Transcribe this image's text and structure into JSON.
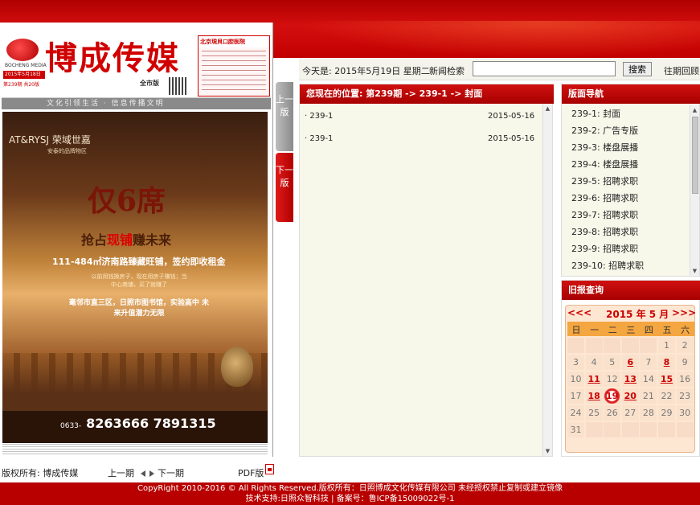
{
  "masthead": {
    "brand": "博成传媒",
    "logo_text": "BOCHENG MEDIA",
    "date_badge": "2015年5月18日",
    "issue_line": "第239期  共20版",
    "edition": "全市版",
    "ad_headline": "北京現貝口腔医院",
    "slogan": "文化引领生活 · 信息传播文明"
  },
  "ad": {
    "brand": "AT&RYSJ 荣域世嘉",
    "tagline": "安泰的品牌物区",
    "big": "仅6席",
    "sub_pre": "抢占",
    "sub_highlight": "现铺",
    "sub_post": "赚未来",
    "line": "111-484㎡济南路臻藏旺铺，签约即收租金",
    "small": "以前用钱换房子，现在用房子赚钱；当中心商铺，买了就赚了",
    "location": "毫邻市直三区，日照市图书馆，实验高中 未来升值潜力无限",
    "phone_label": "0633-",
    "phone": "8263666  7891315"
  },
  "page_buttons": {
    "prev": "上一版",
    "next": "下一版"
  },
  "datebar": {
    "today": "今天是: 2015年5月19日 星期二",
    "search_label": "新闻检索",
    "search_value": "",
    "search_button": "搜索",
    "history": "往期回顾"
  },
  "middle": {
    "location": "您现在的位置: 第239期 -> 239-1 -> 封面",
    "articles": [
      {
        "title": "· 239-1",
        "date": "2015-05-16"
      },
      {
        "title": "· 239-1",
        "date": "2015-05-16"
      }
    ]
  },
  "right": {
    "title": "版面导航",
    "items": [
      "239-1: 封面",
      "239-2: 广告专版",
      "239-3: 楼盘展播",
      "239-4: 楼盘展播",
      "239-5: 招聘求职",
      "239-6: 招聘求职",
      "239-7: 招聘求职",
      "239-8: 招聘求职",
      "239-9: 招聘求职",
      "239-10: 招聘求职"
    ]
  },
  "calendar": {
    "title": "旧报查询",
    "prev": "<<<",
    "month": "2015 年 5 月",
    "next": ">>>",
    "weekdays": [
      "日",
      "一",
      "二",
      "三",
      "四",
      "五",
      "六"
    ],
    "rows": [
      [
        "",
        "",
        "",
        "",
        "",
        "1",
        "2"
      ],
      [
        "3",
        "4",
        "5",
        "6",
        "7",
        "8",
        "9"
      ],
      [
        "10",
        "11",
        "12",
        "13",
        "14",
        "15",
        "16"
      ],
      [
        "17",
        "18",
        "19",
        "20",
        "21",
        "22",
        "23"
      ],
      [
        "24",
        "25",
        "26",
        "27",
        "28",
        "29",
        "30"
      ],
      [
        "31",
        "",
        "",
        "",
        "",
        "",
        ""
      ]
    ],
    "linked_days": [
      "6",
      "8",
      "11",
      "13",
      "15",
      "18",
      "20"
    ],
    "today": "19"
  },
  "bottombar": {
    "owner": "版权所有: 博成传媒",
    "prev_issue": "上一期",
    "next_issue": "下一期",
    "pdf": "PDF版"
  },
  "copyright": {
    "line1": "CopyRight 2010-2016 © All Rights Reserved.版权所有：日照博成文化传媒有限公司 未经授权禁止复制或建立镜像",
    "line2": "技术支持:日照众智科技 | 备案号：鲁ICP备15009022号-1"
  },
  "colors": {
    "brand_red": "#c00000",
    "calendar_bg": "#fde7d3",
    "weekday_bar": "#f4a640"
  }
}
